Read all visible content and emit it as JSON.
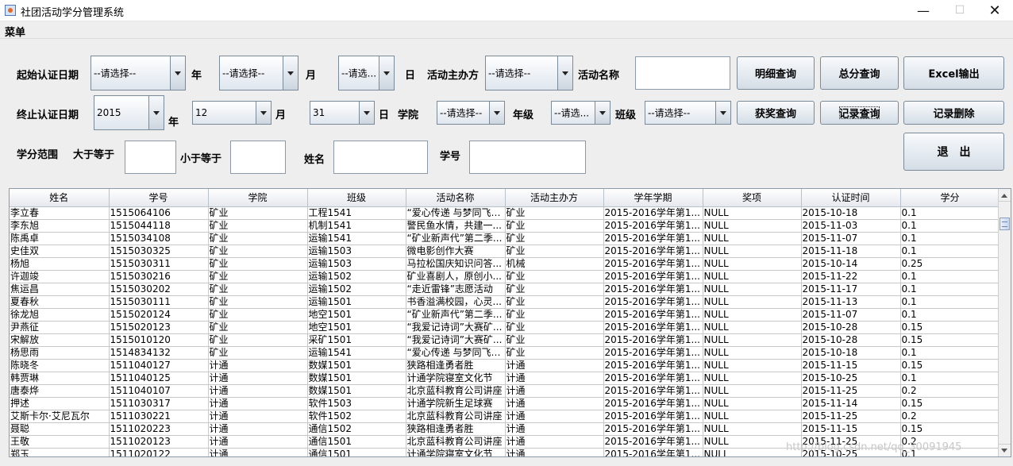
{
  "window": {
    "title": "社团活动学分管理系统",
    "minimize": "—",
    "maximize": "☐",
    "close": "✕"
  },
  "menubar": {
    "menu_label": "菜单"
  },
  "filters": {
    "start_date_label": "起始认证日期",
    "start_year": "--请选择--",
    "year_label": "年",
    "start_month": "--请选择--",
    "month_label": "月",
    "start_day": "--请选...",
    "day_label": "日",
    "organizer_label": "活动主办方",
    "organizer": "--请选择--",
    "activity_name_label": "活动名称",
    "activity_name_value": "",
    "end_date_label": "终止认证日期",
    "end_year": "2015",
    "end_month": "12",
    "end_day": "31",
    "college_label": "学院",
    "college": "--请选择--",
    "grade_label": "年级",
    "grade": "--请选...",
    "class_label": "班级",
    "class": "--请选择--",
    "credit_range_label": "学分范围",
    "gte_label": "大于等于",
    "gte_value": "",
    "lte_label": "小于等于",
    "lte_value": "",
    "name_label": "姓名",
    "name_value": "",
    "student_id_label": "学号",
    "student_id_value": ""
  },
  "buttons": {
    "detail_query": "明细查询",
    "total_query": "总分查询",
    "excel_export": "Excel输出",
    "award_query": "获奖查询",
    "record_query": "记录查询",
    "record_delete": "记录删除",
    "exit": "退　出"
  },
  "table": {
    "columns": [
      "姓名",
      "学号",
      "学院",
      "班级",
      "活动名称",
      "活动主办方",
      "学年学期",
      "奖项",
      "认证时间",
      "学分"
    ],
    "rows": [
      [
        "李立春",
        "1515064106",
        "矿业",
        "工程1541",
        "“爱心传递 与梦同飞”...",
        "矿业",
        "2015-2016学年第1...",
        "NULL",
        "2015-10-18",
        "0.1"
      ],
      [
        "李东旭",
        "1515044118",
        "矿业",
        "机制1541",
        "警民鱼水情，共建一...",
        "矿业",
        "2015-2016学年第1...",
        "NULL",
        "2015-11-03",
        "0.1"
      ],
      [
        "陈禹卓",
        "1515034108",
        "矿业",
        "运输1541",
        "“矿业新声代”第二季...",
        "矿业",
        "2015-2016学年第1...",
        "NULL",
        "2015-11-07",
        "0.1"
      ],
      [
        "史佳双",
        "1515030325",
        "矿业",
        "运输1503",
        "微电影创作大赛",
        "矿业",
        "2015-2016学年第1...",
        "NULL",
        "2015-11-18",
        "0.1"
      ],
      [
        "杨旭",
        "1515030311",
        "矿业",
        "运输1503",
        "马拉松国庆知识问答...",
        "机械",
        "2015-2016学年第1...",
        "NULL",
        "2015-10-14",
        "0.25"
      ],
      [
        "许迦竣",
        "1515030216",
        "矿业",
        "运输1502",
        "矿业喜剧人，原创小...",
        "矿业",
        "2015-2016学年第1...",
        "NULL",
        "2015-11-22",
        "0.1"
      ],
      [
        "焦运昌",
        "1515030202",
        "矿业",
        "运输1502",
        "“走近雷锋”志愿活动",
        "矿业",
        "2015-2016学年第1...",
        "NULL",
        "2015-11-17",
        "0.1"
      ],
      [
        "夏春秋",
        "1515030111",
        "矿业",
        "运输1501",
        "书香溢满校园，心灵...",
        "矿业",
        "2015-2016学年第1...",
        "NULL",
        "2015-11-13",
        "0.1"
      ],
      [
        "徐龙旭",
        "1515020124",
        "矿业",
        "地空1501",
        "“矿业新声代”第二季...",
        "矿业",
        "2015-2016学年第1...",
        "NULL",
        "2015-11-07",
        "0.1"
      ],
      [
        "尹燕征",
        "1515020123",
        "矿业",
        "地空1501",
        "“我爱记诗词”大赛矿...",
        "矿业",
        "2015-2016学年第1...",
        "NULL",
        "2015-10-28",
        "0.15"
      ],
      [
        "宋解放",
        "1515010120",
        "矿业",
        "采矿1501",
        "“我爱记诗词”大赛矿...",
        "矿业",
        "2015-2016学年第1...",
        "NULL",
        "2015-10-28",
        "0.15"
      ],
      [
        "杨思雨",
        "1514834132",
        "矿业",
        "运输1541",
        "“爱心传递 与梦同飞”...",
        "矿业",
        "2015-2016学年第1...",
        "NULL",
        "2015-10-18",
        "0.1"
      ],
      [
        "陈晓冬",
        "1511040127",
        "计通",
        "数媒1501",
        "狭路相逢勇者胜",
        "计通",
        "2015-2016学年第1...",
        "NULL",
        "2015-11-15",
        "0.15"
      ],
      [
        "韩贾琳",
        "1511040125",
        "计通",
        "数媒1501",
        "计通学院寝室文化节",
        "计通",
        "2015-2016学年第1...",
        "NULL",
        "2015-10-25",
        "0.1"
      ],
      [
        "唐泰烨",
        "1511040107",
        "计通",
        "数媒1501",
        "北京蓝科教育公司讲座",
        "计通",
        "2015-2016学年第1...",
        "NULL",
        "2015-11-25",
        "0.2"
      ],
      [
        "押述",
        "1511030317",
        "计通",
        "软件1503",
        "计通学院新生足球赛",
        "计通",
        "2015-2016学年第1...",
        "NULL",
        "2015-11-14",
        "0.15"
      ],
      [
        "艾斯卡尔·艾尼瓦尔",
        "1511030221",
        "计通",
        "软件1502",
        "北京蓝科教育公司讲座",
        "计通",
        "2015-2016学年第1...",
        "NULL",
        "2015-11-25",
        "0.2"
      ],
      [
        "聂聪",
        "1511020223",
        "计通",
        "通信1502",
        "狭路相逢勇者胜",
        "计通",
        "2015-2016学年第1...",
        "NULL",
        "2015-11-15",
        "0.15"
      ],
      [
        "王敬",
        "1511020123",
        "计通",
        "通信1501",
        "北京蓝科教育公司讲座",
        "计通",
        "2015-2016学年第1...",
        "NULL",
        "2015-11-25",
        "0.2"
      ],
      [
        "郑玉",
        "1511020122",
        "计通",
        "通信1501",
        "计通学院寝室文化节",
        "计通",
        "2015-2016学年第1...",
        "NULL",
        "2015-10-25",
        "0.1"
      ]
    ]
  },
  "watermark": "http://blog.csdn.net/qq_30091945"
}
